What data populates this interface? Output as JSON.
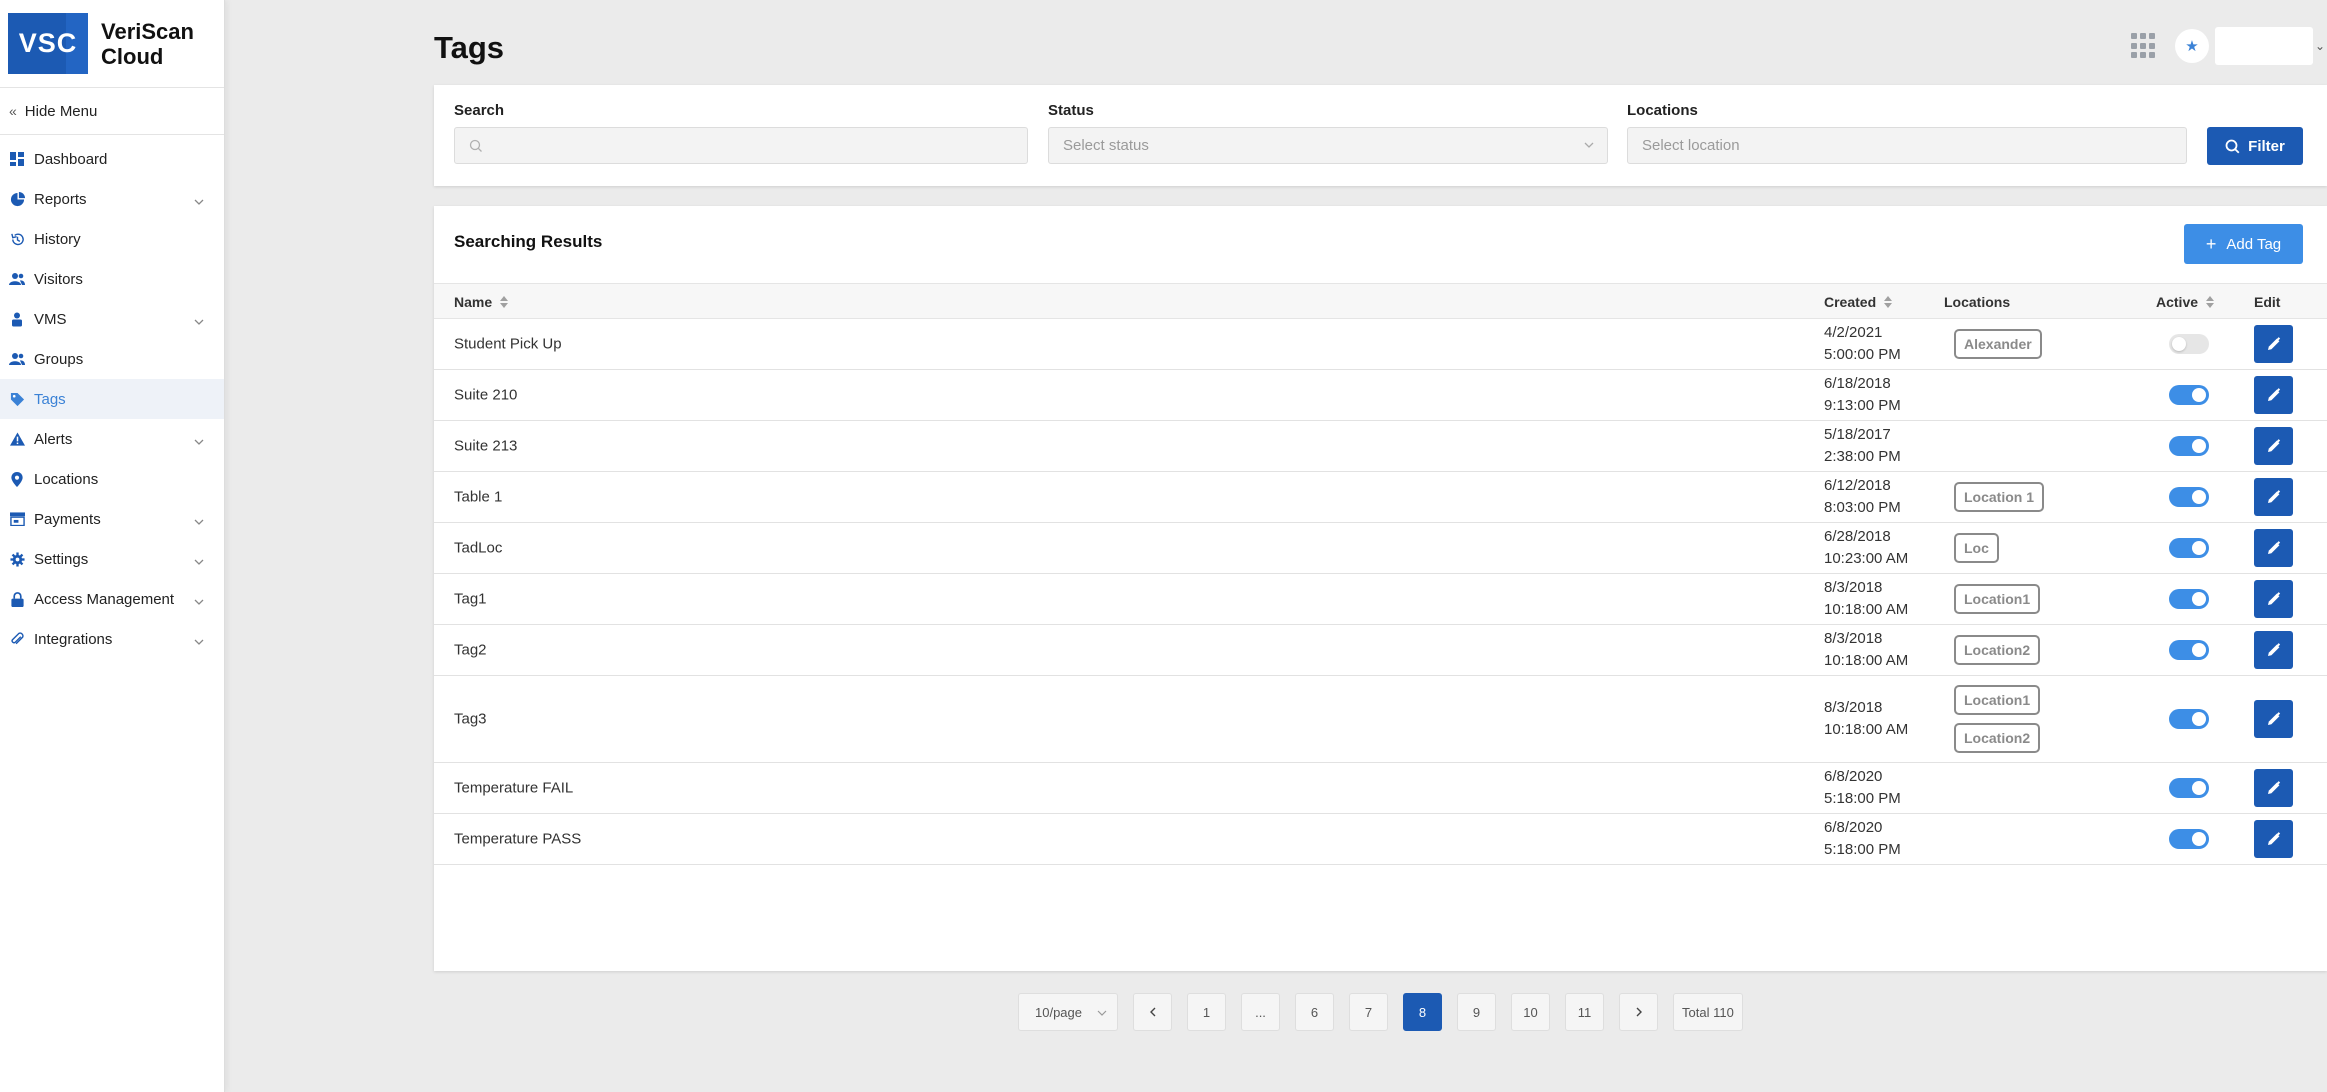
{
  "brand": {
    "logo_text": "VSC",
    "name_line1": "VeriScan",
    "name_line2": "Cloud"
  },
  "sidebar": {
    "hide_menu_label": "Hide Menu",
    "items": [
      {
        "label": "Dashboard",
        "icon": "dashboard-icon",
        "has_submenu": false,
        "active": false
      },
      {
        "label": "Reports",
        "icon": "pie-chart-icon",
        "has_submenu": true,
        "active": false
      },
      {
        "label": "History",
        "icon": "history-icon",
        "has_submenu": false,
        "active": false
      },
      {
        "label": "Visitors",
        "icon": "users-icon",
        "has_submenu": false,
        "active": false
      },
      {
        "label": "VMS",
        "icon": "person-badge-icon",
        "has_submenu": true,
        "active": false
      },
      {
        "label": "Groups",
        "icon": "group-icon",
        "has_submenu": false,
        "active": false
      },
      {
        "label": "Tags",
        "icon": "tag-icon",
        "has_submenu": false,
        "active": true
      },
      {
        "label": "Alerts",
        "icon": "warning-icon",
        "has_submenu": true,
        "active": false
      },
      {
        "label": "Locations",
        "icon": "map-pin-icon",
        "has_submenu": false,
        "active": false
      },
      {
        "label": "Payments",
        "icon": "store-icon",
        "has_submenu": true,
        "active": false
      },
      {
        "label": "Settings",
        "icon": "gear-icon",
        "has_submenu": true,
        "active": false
      },
      {
        "label": "Access Management",
        "icon": "lock-icon",
        "has_submenu": true,
        "active": false
      },
      {
        "label": "Integrations",
        "icon": "paperclip-icon",
        "has_submenu": true,
        "active": false
      }
    ]
  },
  "header": {
    "title": "Tags"
  },
  "filters": {
    "search_label": "Search",
    "search_value": "",
    "status_label": "Status",
    "status_placeholder": "Select status",
    "locations_label": "Locations",
    "locations_placeholder": "Select location",
    "filter_button": "Filter"
  },
  "results": {
    "title": "Searching Results",
    "add_button": "Add Tag",
    "columns": {
      "name": "Name",
      "created": "Created",
      "locations": "Locations",
      "active": "Active",
      "edit": "Edit"
    },
    "rows": [
      {
        "name": "Student Pick Up",
        "created_date": "4/2/2021",
        "created_time": "5:00:00 PM",
        "locations": [
          "Alexander"
        ],
        "active": false
      },
      {
        "name": "Suite 210",
        "created_date": "6/18/2018",
        "created_time": "9:13:00 PM",
        "locations": [],
        "active": true
      },
      {
        "name": "Suite 213",
        "created_date": "5/18/2017",
        "created_time": "2:38:00 PM",
        "locations": [],
        "active": true
      },
      {
        "name": "Table 1",
        "created_date": "6/12/2018",
        "created_time": "8:03:00 PM",
        "locations": [
          "Location 1"
        ],
        "active": true
      },
      {
        "name": "TadLoc",
        "created_date": "6/28/2018",
        "created_time": "10:23:00 AM",
        "locations": [
          "Loc"
        ],
        "active": true
      },
      {
        "name": "Tag1",
        "created_date": "8/3/2018",
        "created_time": "10:18:00 AM",
        "locations": [
          "Location1"
        ],
        "active": true
      },
      {
        "name": "Tag2",
        "created_date": "8/3/2018",
        "created_time": "10:18:00 AM",
        "locations": [
          "Location2"
        ],
        "active": true
      },
      {
        "name": "Tag3",
        "created_date": "8/3/2018",
        "created_time": "10:18:00 AM",
        "locations": [
          "Location1",
          "Location2"
        ],
        "active": true
      },
      {
        "name": "Temperature FAIL",
        "created_date": "6/8/2020",
        "created_time": "5:18:00 PM",
        "locations": [],
        "active": true
      },
      {
        "name": "Temperature PASS",
        "created_date": "6/8/2020",
        "created_time": "5:18:00 PM",
        "locations": [],
        "active": true
      }
    ]
  },
  "pagination": {
    "page_size": "10/page",
    "pages": [
      "1",
      "...",
      "6",
      "7",
      "8",
      "9",
      "10",
      "11"
    ],
    "current": "8",
    "total": "Total 110"
  },
  "colors": {
    "primary": "#1c5ab3",
    "accent": "#3d8ee6",
    "active_nav": "#3b82d6",
    "tag_border": "#8a8a8a"
  }
}
